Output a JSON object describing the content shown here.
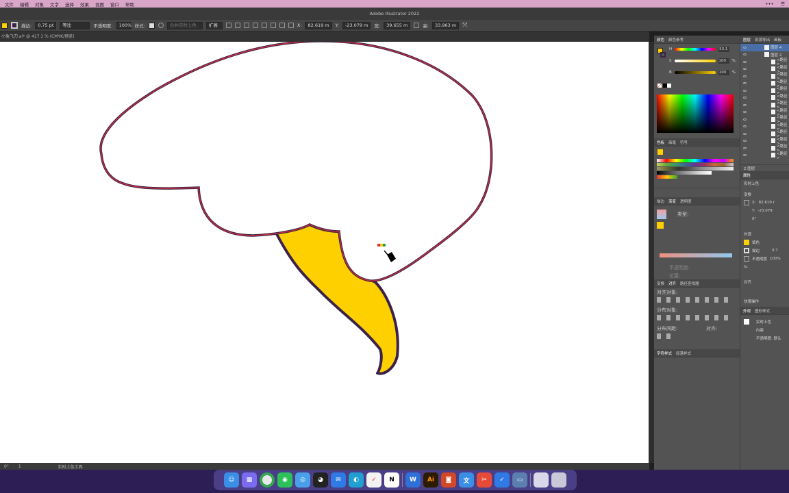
{
  "menubar": {
    "items": [
      "文件",
      "编辑",
      "对象",
      "文字",
      "选择",
      "效果",
      "视图",
      "窗口",
      "帮助"
    ]
  },
  "titlebar": {
    "title": "Adobe Illustrator 2022"
  },
  "control_bar": {
    "stroke_label": "描边:",
    "stroke_value": "0.75 pt",
    "profile_value": "等比",
    "opacity_label": "不透明度:",
    "opacity_value": "100%",
    "style_label": "样式:",
    "merge_label": "合并实时上色",
    "expand_label": "扩展",
    "x_label": "X:",
    "x_value": "82.619 m",
    "y_label": "Y:",
    "y_value": "-23.079 m",
    "w_label": "宽:",
    "w_value": "39.655 m",
    "h_label": "高:",
    "h_value": "33.963 m"
  },
  "doc_tab": {
    "title": "小兔飞刀.ai* @ 417.1 % (CMYK/预览)"
  },
  "status_bar": {
    "angle": "0°",
    "page": "1",
    "tool": "实时上色工具"
  },
  "color_panel": {
    "tabs": [
      "颜色",
      "颜色参考"
    ],
    "h_label": "H",
    "h_value": "53.1",
    "s_label": "S",
    "s_value": "100",
    "b_label": "B",
    "b_value": "100",
    "pct": "%"
  },
  "swatches_panel": {
    "tabs": [
      "色板",
      "画笔",
      "符号"
    ]
  },
  "gradient_panel": {
    "tabs": [
      "描边",
      "渐变",
      "透明度"
    ],
    "type_label": "类型:",
    "opacity_label": "不透明度:",
    "position_label": "位置:"
  },
  "align_panel": {
    "tabs": [
      "变换",
      "对齐",
      "路径查找器"
    ],
    "align_objects": "对齐对象:",
    "distribute_objects": "分布对象:",
    "distribute_spacing": "分布间距:",
    "align_to": "对齐:"
  },
  "char_panel": {
    "tabs": [
      "字符样式",
      "段落样式"
    ]
  },
  "layers_panel": {
    "tabs": [
      "图层",
      "资源导出",
      "画板"
    ],
    "layer1": "图层 4",
    "layer2": "图层 2",
    "sublabel": "<路径>",
    "bottom_label": "2 图层"
  },
  "properties_panel": {
    "title": "属性",
    "subtitle": "实时上色",
    "transform_label": "变换",
    "x_label": "X:",
    "x_value": "82.619 r",
    "y_label": "Y:",
    "y_value": "-23.079",
    "angle": "0°",
    "appearance_label": "外观",
    "fill_label": "填色",
    "stroke_label": "描边",
    "stroke_value": "0.7",
    "opacity_label": "不透明度",
    "opacity_value": "100%",
    "fx": "fx.",
    "align_label": "对齐",
    "quick_label": "快速操作"
  },
  "appearance_panel": {
    "tabs": [
      "外观",
      "图形样式"
    ],
    "item_title": "实时上色",
    "content_label": "内容",
    "opacity_label": "不透明度: 默认"
  },
  "colors": {
    "fill": "#ffd000",
    "stroke_outline": "#3a2248",
    "stroke_red": "#c0303a",
    "menubar": "#d9a6c8"
  },
  "dock": {
    "apps": [
      "finder-icon",
      "launchpad-icon",
      "chrome-icon",
      "wechat-icon",
      "qq-browser-icon",
      "qq-icon",
      "mail-icon",
      "edge-icon",
      "calendar-icon",
      "notion-icon",
      "word-icon",
      "illustrator-icon",
      "powerpoint-icon",
      "translate-icon",
      "cut-icon",
      "safari-icon",
      "preview-icon",
      "folder-icon",
      "trash-icon"
    ],
    "ai_label": "Ai",
    "n_label": "N",
    "w_label": "W"
  }
}
